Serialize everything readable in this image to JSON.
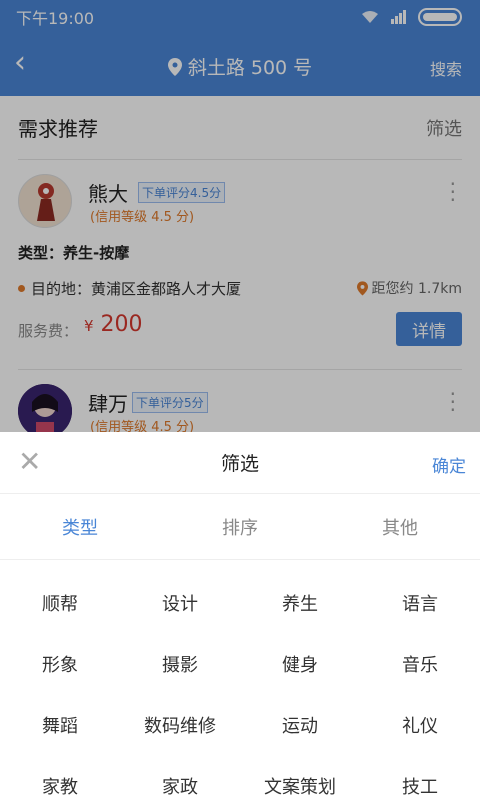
{
  "status": {
    "time": "下午19:00"
  },
  "header": {
    "location": "斜土路 500 号",
    "search_label": "搜索"
  },
  "recommend": {
    "title": "需求推荐",
    "filter_label": "筛选"
  },
  "cards": [
    {
      "name": "熊大",
      "rating_tag": "下单评分4.5分",
      "credit": "(信用等级 4.5 分)",
      "type": "类型：养生-按摩",
      "destination": "目的地：黄浦区金都路人才大厦",
      "distance": "距您约 1.7km",
      "fee_label": "服务费：",
      "fee_currency": "¥",
      "fee_value": "200",
      "detail_button": "详情"
    },
    {
      "name": "肆万",
      "rating_tag": "下单评分5分",
      "credit": "(信用等级 4.5 分)"
    }
  ],
  "sheet": {
    "title": "筛选",
    "confirm_label": "确定",
    "tabs": [
      "类型",
      "排序",
      "其他"
    ],
    "active_tab": 0,
    "options": [
      "顺帮",
      "设计",
      "养生",
      "语言",
      "形象",
      "摄影",
      "健身",
      "音乐",
      "舞蹈",
      "数码维修",
      "运动",
      "礼仪",
      "家教",
      "家政",
      "文案策划",
      "技工"
    ]
  },
  "colors": {
    "accent": "#4a86d6",
    "price": "#d6382e",
    "credit": "#e07a2b"
  }
}
